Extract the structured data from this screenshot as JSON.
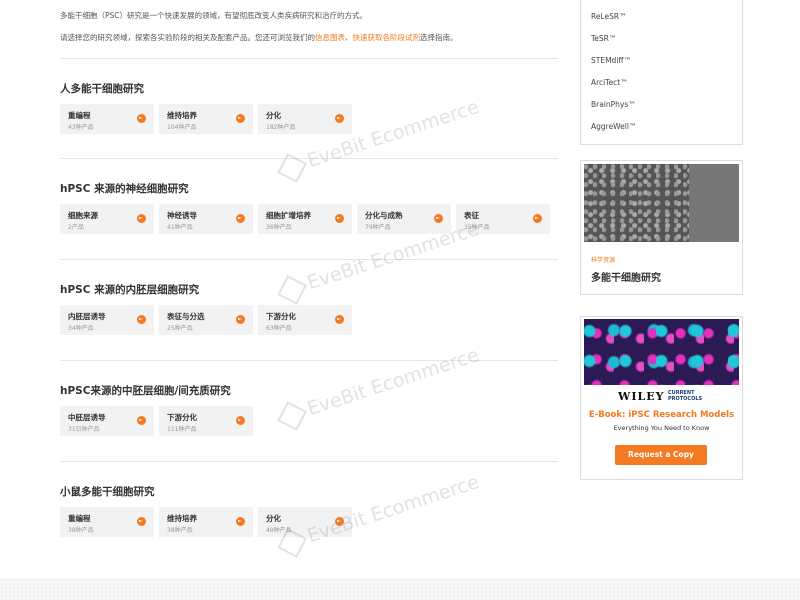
{
  "intro": {
    "p1": "多能干细胞（PSC）研究是一个快速发展的领域，有望彻底改变人类疾病研究和治疗的方式。",
    "p2_prefix": "请选择您的研究领域，探索各实验阶段的相关及配套产品。您还可浏览我们的",
    "p2_link1": "信息图表",
    "p2_sep": "、",
    "p2_link2": "快速获取各阶段试剂",
    "p2_suffix": "选择指南。"
  },
  "sections": [
    {
      "title": "人多能干细胞研究",
      "cards": [
        {
          "name": "重编程",
          "count": "43种产品"
        },
        {
          "name": "维持培养",
          "count": "104种产品"
        },
        {
          "name": "分化",
          "count": "182种产品"
        }
      ]
    },
    {
      "title": "hPSC 来源的神经细胞研究",
      "cards": [
        {
          "name": "细胞来源",
          "count": "2产品"
        },
        {
          "name": "神经诱导",
          "count": "41种产品"
        },
        {
          "name": "细胞扩增培养",
          "count": "36种产品"
        },
        {
          "name": "分化与成熟",
          "count": "79种产品"
        },
        {
          "name": "表征",
          "count": "35种产品"
        }
      ]
    },
    {
      "title": "hPSC 来源的内胚层细胞研究",
      "cards": [
        {
          "name": "内胚层诱导",
          "count": "34种产品"
        },
        {
          "name": "表征与分选",
          "count": "25种产品"
        },
        {
          "name": "下游分化",
          "count": "63种产品"
        }
      ]
    },
    {
      "title": "hPSC来源的中胚层细胞/间充质研究",
      "cards": [
        {
          "name": "中胚层诱导",
          "count": "31日种产品"
        },
        {
          "name": "下游分化",
          "count": "111种产品"
        }
      ]
    },
    {
      "title": "小鼠多能干细胞研究",
      "cards": [
        {
          "name": "重编程",
          "count": "38种产品"
        },
        {
          "name": "维持培养",
          "count": "38种产品"
        },
        {
          "name": "分化",
          "count": "49种产品"
        }
      ]
    }
  ],
  "sidebar": {
    "brands": [
      "ReLeSR™",
      "TeSR™",
      "STEMdiff™",
      "ArciTect™",
      "BrainPhys™",
      "AggreWell™"
    ],
    "feature": {
      "tag": "科学资源",
      "title": "多能干细胞研究"
    },
    "ad": {
      "publisher": "WILEY",
      "series": "CURRENT PROTOCOLS",
      "ebook": "E-Book: iPSC Research Models",
      "subtitle": "Everything You Need to Know",
      "button": "Request a Copy"
    }
  },
  "watermark": "EveBit Ecommerce",
  "colors": {
    "accent": "#f47920",
    "card": "#f2f2f2",
    "border": "#dddddd"
  }
}
